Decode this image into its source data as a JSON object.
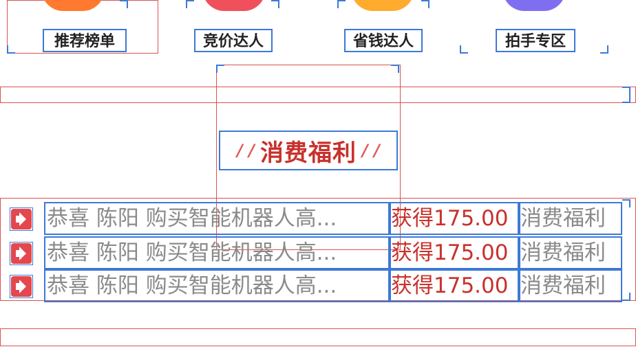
{
  "nav_grid": [
    {
      "label": "推荐榜单",
      "icon": "orange-rounded-icon",
      "color": "#ff7a2f"
    },
    {
      "label": "竞价达人",
      "icon": "red-rounded-icon",
      "color": "#f0505c"
    },
    {
      "label": "省钱达人",
      "icon": "yellow-rounded-icon",
      "color": "#ffab2e"
    },
    {
      "label": "拍手专区",
      "icon": "purple-rounded-icon",
      "color": "#7f6ff0"
    }
  ],
  "section": {
    "title": "消费福利",
    "decoration": "/ /"
  },
  "notices": [
    {
      "text": "恭喜 陈阳 购买智能机器人高...",
      "amount": "获得175.00",
      "tag": "消费福利",
      "icon": "megaphone-icon"
    },
    {
      "text": "恭喜 陈阳 购买智能机器人高...",
      "amount": "获得175.00",
      "tag": "消费福利",
      "icon": "megaphone-icon"
    },
    {
      "text": "恭喜 陈阳 购买智能机器人高...",
      "amount": "获得175.00",
      "tag": "消费福利",
      "icon": "megaphone-icon"
    }
  ],
  "colors": {
    "accent_red": "#c8312c",
    "bounds_blue": "#3c78d8",
    "bounds_red": "#d9534f",
    "muted_text": "#8a8a8a"
  }
}
